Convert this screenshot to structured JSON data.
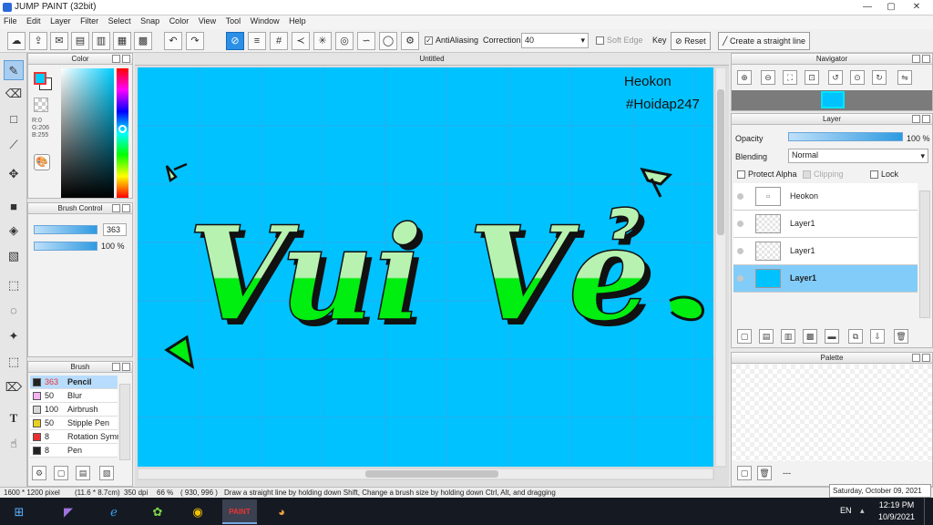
{
  "window": {
    "title": "JUMP PAINT (32bit)"
  },
  "menu": [
    "File",
    "Edit",
    "Layer",
    "Filter",
    "Select",
    "Snap",
    "Color",
    "View",
    "Tool",
    "Window",
    "Help"
  ],
  "toolbar": {
    "antialiasing_label": "AntiAliasing",
    "correction_label": "Correction",
    "correction_value": "40",
    "soft_edge_label": "Soft Edge",
    "key_label": "Key",
    "reset_label": "Reset",
    "straight_line_label": "Create a straight line"
  },
  "color_panel": {
    "title": "Color",
    "r": "R:0",
    "g": "G:206",
    "b": "B:255",
    "fg_color": "#00ceff"
  },
  "brush_control": {
    "title": "Brush Control",
    "size": "363",
    "opacity": "100 %"
  },
  "brush_panel": {
    "title": "Brush",
    "items": [
      {
        "size": "363",
        "name": "Pencil",
        "color": "#222222",
        "selected": true
      },
      {
        "size": "50",
        "name": "Blur",
        "color": "#f4b2f4",
        "selected": false
      },
      {
        "size": "100",
        "name": "Airbrush",
        "color": "#d8d8d8",
        "selected": false
      },
      {
        "size": "50",
        "name": "Stipple Pen",
        "color": "#e8d020",
        "selected": false
      },
      {
        "size": "8",
        "name": "Rotation Symm",
        "color": "#e83030",
        "selected": false
      },
      {
        "size": "8",
        "name": "Pen",
        "color": "#222222",
        "selected": false
      }
    ]
  },
  "document": {
    "tab_title": "Untitled",
    "canvas_color": "#00c2ff",
    "watermark_line1": "Heokon",
    "watermark_line2": "#Hoidap247",
    "lettering": "Vui Vẻ"
  },
  "navigator": {
    "title": "Navigator"
  },
  "layer_panel": {
    "title": "Layer",
    "opacity_label": "Opacity",
    "opacity_value": "100 %",
    "blending_label": "Blending",
    "blending_value": "Normal",
    "protect_alpha_label": "Protect Alpha",
    "clipping_label": "Clipping",
    "lock_label": "Lock",
    "layers": [
      {
        "name": "Heokon",
        "selected": false
      },
      {
        "name": "Layer1",
        "selected": false
      },
      {
        "name": "Layer1",
        "selected": false
      },
      {
        "name": "Layer1",
        "selected": true
      }
    ]
  },
  "palette_panel": {
    "title": "Palette",
    "footer_text": "---"
  },
  "status": {
    "size": "1600 * 1200 pixel",
    "dimension": "(11.6 * 8.7cm)",
    "dpi": "350 dpi",
    "zoom": "66 %",
    "coords": "( 930, 996 )",
    "hint": "Draw a straight line by holding down Shift, Change a brush size by holding down Ctrl, Alt, and dragging",
    "date_tooltip": "Saturday, October 09, 2021"
  },
  "taskbar": {
    "lang": "EN",
    "time": "12:19 PM",
    "date": "10/9/2021"
  }
}
